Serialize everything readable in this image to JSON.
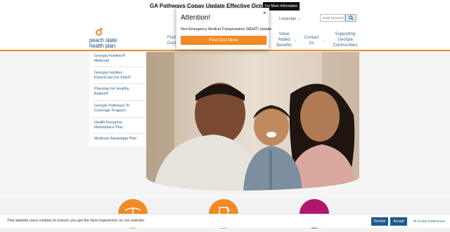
{
  "announcement": {
    "text": "GA Pathways Copay Update Effective October 1, 2025",
    "button": "For More Information"
  },
  "utility": {
    "lang_prefix": "A",
    "language": "Language ⌄",
    "search_placeholder": "Enter Keyword"
  },
  "logo": {
    "line1": "peach state",
    "line2": "health plan."
  },
  "nav": {
    "find_docs": "Find a\nDoctor",
    "value_added": "Value\nAdded\nBenefits",
    "contact": "Contact\nUs",
    "supporting": "Supporting\nGeorgia\nCommunities"
  },
  "sidebar": [
    "Georgia Families®\nMedicaid",
    "Georgia Families\nPeachCare For Kids®",
    "Planning For Healthy\nBabies®",
    "Georgia Pathways To\nCoverage Program",
    "Health Insurance\nMarketplace Plan",
    "Medicare Advantage Plan"
  ],
  "modal": {
    "title": "Attention!",
    "body": "Non-Emergency Medical Transportation (NEMT) Update",
    "button": "Find Out More",
    "close": "×"
  },
  "cookie": {
    "text": "This website uses cookies to ensure you get the best experience on our website.",
    "decline": "Decline",
    "accept": "Accept",
    "prefs": "Cookie Preferences"
  },
  "colors": {
    "accent": "#f08a24",
    "navy": "#1e5a8e",
    "circle_orange": "#f08a24",
    "circle_magenta": "#b0166e"
  }
}
